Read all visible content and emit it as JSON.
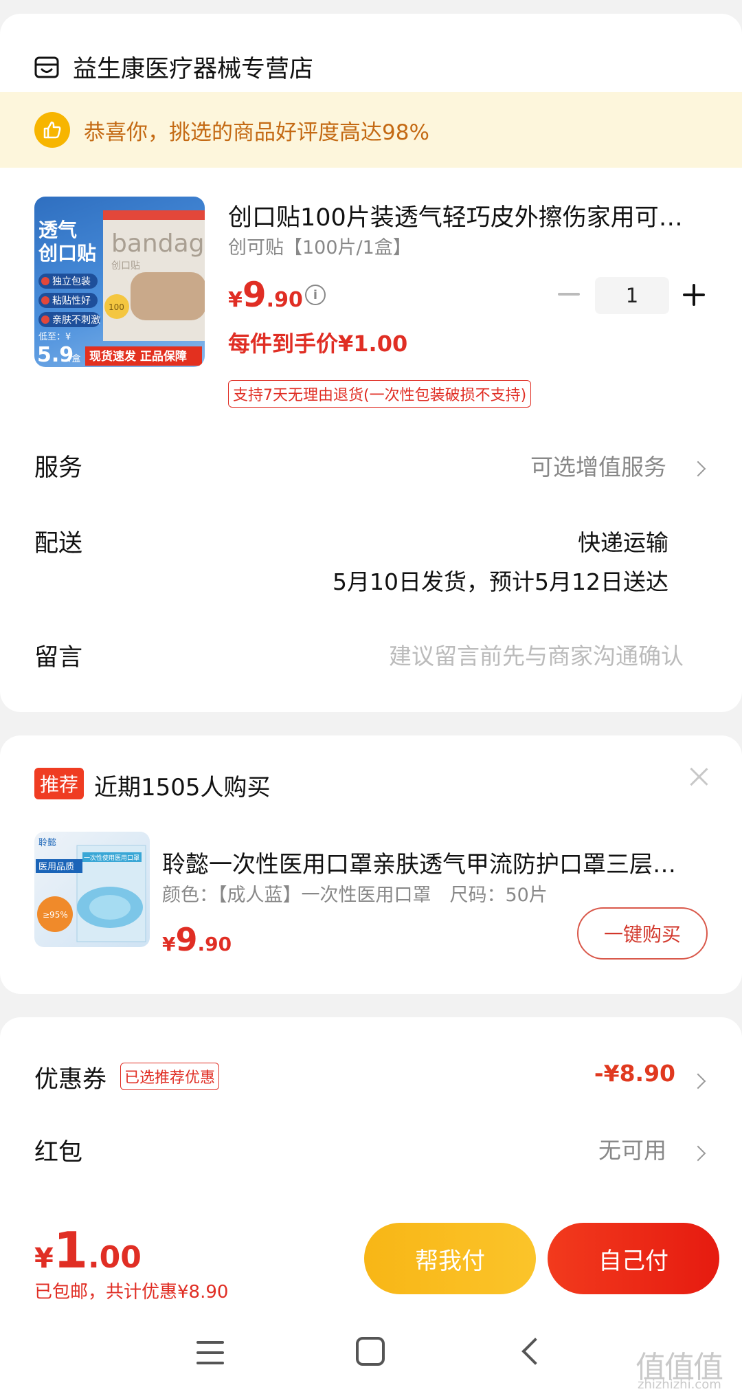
{
  "store": {
    "name": "益生康医疗器械专营店",
    "icon": "store-icon"
  },
  "banner": {
    "text": "恭喜你，挑选的商品好评度高达98%",
    "icon": "thumbs-up-icon",
    "bg": "#fdf6dc"
  },
  "product": {
    "title": "创口贴100片装透气轻巧皮外擦伤家用可…",
    "spec": "创可贴【100片/1盒】",
    "price": {
      "currency": "¥",
      "integer": "9",
      "decimal": ".90"
    },
    "quantity": "1",
    "unit_price": "每件到手价¥1.00",
    "return_policy": "支持7天无理由退货(一次性包装破损不支持)",
    "image": {
      "badge_line1": "透气",
      "badge_line2": "创口贴",
      "features": [
        "独立包装",
        "粘贴性好",
        "亲肤不刺激"
      ],
      "low_label": "低至：¥",
      "low_price": "5.9",
      "low_unit": "/盒",
      "footer": "现货速发 正品保障",
      "box_brand": "bandage",
      "box_sub": "创口贴",
      "box_count": "100"
    }
  },
  "rows": {
    "service": {
      "label": "服务",
      "value": "可选增值服务"
    },
    "delivery": {
      "label": "配送",
      "method": "快递运输",
      "schedule": "5月10日发货，预计5月12日送达"
    },
    "message": {
      "label": "留言",
      "placeholder": "建议留言前先与商家沟通确认"
    }
  },
  "recommendation": {
    "badge": "推荐",
    "title": "近期1505人购买",
    "item": {
      "name": "聆懿一次性医用口罩亲肤透气甲流防护口罩三层…",
      "spec": "颜色：【成人蓝】一次性医用口罩　尺码：50片",
      "price": {
        "currency": "¥",
        "integer": "9",
        "decimal": ".90"
      },
      "button": "一键购买",
      "image": {
        "brand": "聆懿",
        "tag": "医用品质",
        "rate": "≥95%",
        "box": "一次性使用医用口罩"
      }
    }
  },
  "coupon": {
    "label": "优惠券",
    "tag": "已选推荐优惠",
    "value": "-¥8.90",
    "redpacket_label": "红包",
    "redpacket_value": "无可用"
  },
  "footer": {
    "total": {
      "currency": "¥",
      "integer": "1",
      "decimal": ".00"
    },
    "note": "已包邮，共计优惠¥8.90",
    "help_pay": "帮我付",
    "self_pay": "自己付"
  },
  "watermark": {
    "main": "值值值",
    "sub": "zhizhizhi.com"
  },
  "colors": {
    "accent_red": "#e02e24",
    "yellow_btn": "#f8b616",
    "banner_text": "#c46a14"
  }
}
